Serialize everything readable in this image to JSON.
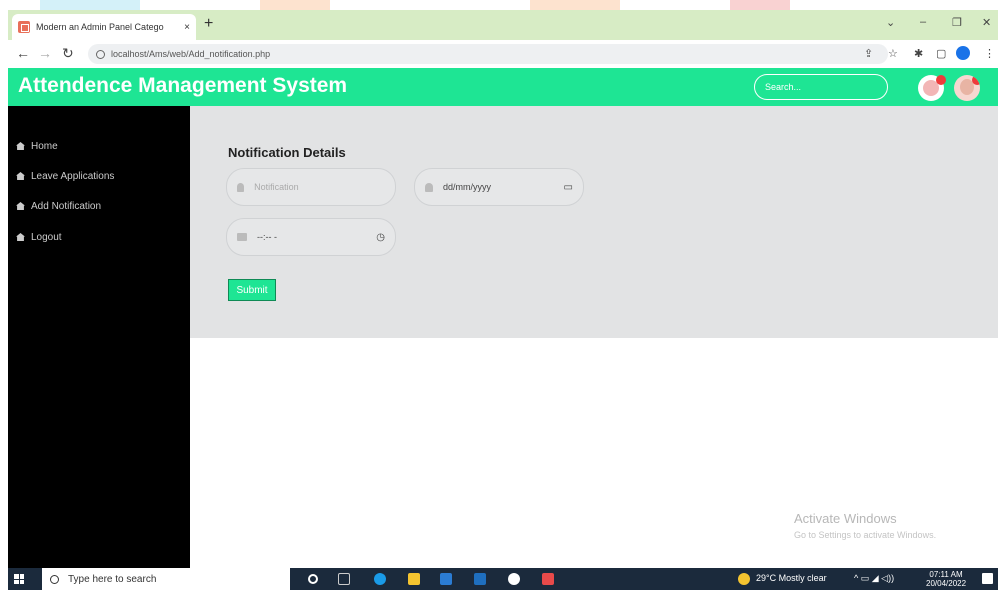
{
  "browser": {
    "tab_title": "Modern an Admin Panel Catego",
    "tab_close": "×",
    "new_tab": "+",
    "url": "localhost/Ams/web/Add_notification.php",
    "win_min": "–",
    "win_max": "❐",
    "win_close": "✕",
    "win_chevron": "⌄"
  },
  "app": {
    "title": "Attendence Management System",
    "search_placeholder": "Search..."
  },
  "sidebar": {
    "items": [
      {
        "label": "Home"
      },
      {
        "label": "Leave Applications"
      },
      {
        "label": "Add Notification"
      },
      {
        "label": "Logout"
      }
    ]
  },
  "form": {
    "title": "Notification Details",
    "notification_placeholder": "Notification",
    "date_placeholder": "dd/mm/yyyy",
    "time_placeholder": "--:-- -",
    "submit_label": "Submit"
  },
  "watermark": {
    "title": "Activate Windows",
    "subtitle": "Go to Settings to activate Windows."
  },
  "taskbar": {
    "search_text": "Type here to search",
    "weather": "29°C  Mostly clear",
    "time": "07:11 AM",
    "date": "20/04/2022"
  },
  "colors": {
    "accent": "#1ee594",
    "sidebar_bg": "#000000",
    "content_bg": "#e2e3e4",
    "tab_bar_bg": "#d7ecc5"
  }
}
